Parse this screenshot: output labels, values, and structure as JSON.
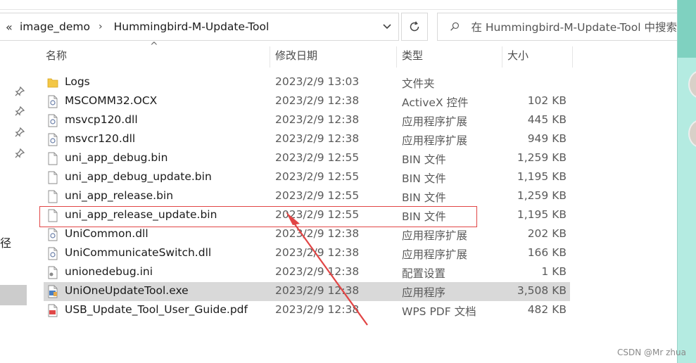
{
  "address": {
    "back_glyph": "«",
    "crumbs": [
      "image_demo",
      "Hummingbird-M-Update-Tool"
    ],
    "separator": "›"
  },
  "search": {
    "placeholder": "在 Hummingbird-M-Update-Tool 中搜索"
  },
  "nav": {
    "clipped_label": "径"
  },
  "columns": {
    "name": "名称",
    "date": "修改日期",
    "type": "类型",
    "size": "大小"
  },
  "files": [
    {
      "name": "Logs",
      "date": "2023/2/9 13:03",
      "type": "文件夹",
      "size": "",
      "icon": "folder-icon"
    },
    {
      "name": "MSCOMM32.OCX",
      "date": "2023/2/9 12:38",
      "type": "ActiveX 控件",
      "size": "102 KB",
      "icon": "activex-file-icon"
    },
    {
      "name": "msvcp120.dll",
      "date": "2023/2/9 12:38",
      "type": "应用程序扩展",
      "size": "445 KB",
      "icon": "dll-file-icon"
    },
    {
      "name": "msvcr120.dll",
      "date": "2023/2/9 12:38",
      "type": "应用程序扩展",
      "size": "949 KB",
      "icon": "dll-file-icon"
    },
    {
      "name": "uni_app_debug.bin",
      "date": "2023/2/9 12:55",
      "type": "BIN 文件",
      "size": "1,259 KB",
      "icon": "bin-file-icon"
    },
    {
      "name": "uni_app_debug_update.bin",
      "date": "2023/2/9 12:55",
      "type": "BIN 文件",
      "size": "1,195 KB",
      "icon": "bin-file-icon"
    },
    {
      "name": "uni_app_release.bin",
      "date": "2023/2/9 12:55",
      "type": "BIN 文件",
      "size": "1,259 KB",
      "icon": "bin-file-icon"
    },
    {
      "name": "uni_app_release_update.bin",
      "date": "2023/2/9 12:55",
      "type": "BIN 文件",
      "size": "1,195 KB",
      "icon": "bin-file-icon"
    },
    {
      "name": "UniCommon.dll",
      "date": "2023/2/9 12:38",
      "type": "应用程序扩展",
      "size": "202 KB",
      "icon": "dll-file-icon"
    },
    {
      "name": "UniCommunicateSwitch.dll",
      "date": "2023/2/9 12:38",
      "type": "应用程序扩展",
      "size": "166 KB",
      "icon": "dll-file-icon"
    },
    {
      "name": "unionedebug.ini",
      "date": "2023/2/9 12:38",
      "type": "配置设置",
      "size": "1 KB",
      "icon": "ini-file-icon"
    },
    {
      "name": "UniOneUpdateTool.exe",
      "date": "2023/2/9 12:38",
      "type": "应用程序",
      "size": "3,508 KB",
      "icon": "exe-file-icon",
      "selected": true
    },
    {
      "name": "USB_Update_Tool_User_Guide.pdf",
      "date": "2023/2/9 12:38",
      "type": "WPS PDF 文档",
      "size": "482 KB",
      "icon": "pdf-file-icon"
    }
  ],
  "annotation": {
    "highlighted_file": "uni_app_release_update.bin",
    "color": "#e14545"
  },
  "watermark": "CSDN @Mr zhua",
  "colors": {
    "selected_row": "#d9d9d9",
    "accent_edge": "#b4ebe1"
  }
}
